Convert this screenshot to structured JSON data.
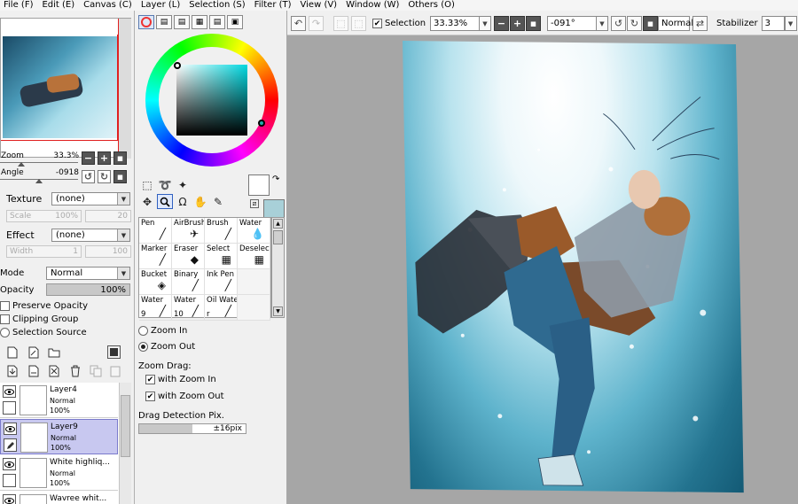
{
  "menu": [
    "File (F)",
    "Edit (E)",
    "Canvas (C)",
    "Layer (L)",
    "Selection (S)",
    "Filter (T)",
    "View (V)",
    "Window (W)",
    "Others (O)"
  ],
  "navigator": {
    "zoom_label": "Zoom",
    "zoom_value": "33.3%",
    "angle_label": "Angle",
    "angle_value": "-0918"
  },
  "texture": {
    "label": "Texture",
    "value": "(none)",
    "scale_label": "Scale",
    "scale_value": "100%",
    "scale_num": "20"
  },
  "effect": {
    "label": "Effect",
    "value": "(none)",
    "width_label": "Width",
    "width_value": "1",
    "width_num": "100"
  },
  "layer_props": {
    "mode_label": "Mode",
    "mode_value": "Normal",
    "opacity_label": "Opacity",
    "opacity_value": "100%",
    "preserve_opacity": "Preserve Opacity",
    "clipping_group": "Clipping Group",
    "selection_source": "Selection Source"
  },
  "layers": [
    {
      "name": "Layer4",
      "mode": "Normal",
      "opacity": "100%",
      "selected": false
    },
    {
      "name": "Layer9",
      "mode": "Normal",
      "opacity": "100%",
      "selected": true
    },
    {
      "name": "White highliq...",
      "mode": "Normal",
      "opacity": "100%",
      "selected": false
    },
    {
      "name": "Wavree whit...",
      "mode": "",
      "opacity": "",
      "selected": false
    }
  ],
  "brushes": [
    {
      "name": "Pen",
      "sub": ""
    },
    {
      "name": "AirBrush",
      "sub": ""
    },
    {
      "name": "Brush",
      "sub": ""
    },
    {
      "name": "Water",
      "sub": ""
    },
    {
      "name": "Marker",
      "sub": ""
    },
    {
      "name": "Eraser",
      "sub": ""
    },
    {
      "name": "Select",
      "sub": ""
    },
    {
      "name": "Deselect",
      "sub": ""
    },
    {
      "name": "Bucket",
      "sub": ""
    },
    {
      "name": "Binary",
      "sub": ""
    },
    {
      "name": "Ink Pen",
      "sub": ""
    },
    {
      "name": "",
      "sub": ""
    },
    {
      "name": "Water",
      "sub": "9"
    },
    {
      "name": "Water",
      "sub": "10"
    },
    {
      "name": "Oil Wate",
      "sub": "r"
    },
    {
      "name": "",
      "sub": ""
    }
  ],
  "zoom_tool": {
    "zoom_in": "Zoom In",
    "zoom_out": "Zoom Out",
    "zoom_drag_label": "Zoom Drag:",
    "with_zoom_in": "with Zoom In",
    "with_zoom_out": "with Zoom Out",
    "drag_detection_label": "Drag Detection Pix.",
    "drag_detection_value": "±16pix"
  },
  "toolbar": {
    "selection_label": "Selection",
    "zoom_value": "33.33%",
    "angle_value": "-091°",
    "blend_mode": "Normal",
    "stabilizer_label": "Stabilizer",
    "stabilizer_value": "3"
  },
  "colors": {
    "canvas_bg": "#a6a6a6",
    "selection": "#c8c8f0",
    "primary": "#ffffff",
    "secondary": "#a8d0d8"
  }
}
